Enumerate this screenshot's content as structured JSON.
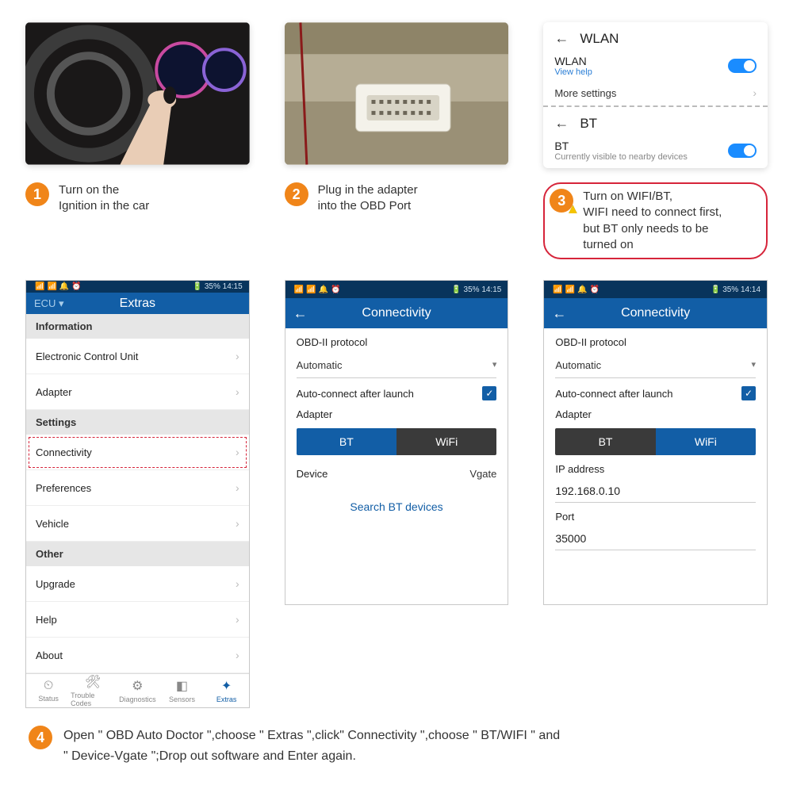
{
  "step1": {
    "num": "1",
    "text": "Turn on the\nIgnition in the car"
  },
  "step2": {
    "num": "2",
    "text": "Plug in the adapter\ninto the OBD Port"
  },
  "step3": {
    "num": "3",
    "text": "Turn on WIFI/BT,\nWIFI need to connect first,\nbut BT only needs to be\nturned on"
  },
  "step4": {
    "num": "4",
    "text": "Open \" OBD Auto Doctor \",choose \" Extras \",click\" Connectivity \",choose \" BT/WIFI \" and\n\" Device-Vgate \";Drop out software and Enter again."
  },
  "settings": {
    "wlan": {
      "title": "WLAN",
      "label": "WLAN",
      "help": "View help",
      "more": "More settings"
    },
    "bt": {
      "title": "BT",
      "label": "BT",
      "sub": "Currently visible to nearby devices"
    }
  },
  "extras": {
    "statusTime": "14:15",
    "statusBatt": "35%",
    "ecu": "ECU  ▾",
    "title": "Extras",
    "sec_info": "Information",
    "i_ecu": "Electronic Control Unit",
    "i_adapter": "Adapter",
    "sec_settings": "Settings",
    "i_conn": "Connectivity",
    "i_pref": "Preferences",
    "i_vehicle": "Vehicle",
    "sec_other": "Other",
    "i_upgrade": "Upgrade",
    "i_help": "Help",
    "i_about": "About",
    "nav": {
      "status": "Status",
      "codes": "Trouble Codes",
      "diag": "Diagnostics",
      "sensors": "Sensors",
      "extras": "Extras"
    }
  },
  "conn_bt": {
    "statusTime": "14:15",
    "statusBatt": "35%",
    "title": "Connectivity",
    "proto_lbl": "OBD-II protocol",
    "proto_val": "Automatic",
    "auto_lbl": "Auto-connect after launch",
    "adapter_lbl": "Adapter",
    "seg_bt": "BT",
    "seg_wifi": "WiFi",
    "device_lbl": "Device",
    "device_val": "Vgate",
    "search": "Search  BT  devices"
  },
  "conn_wifi": {
    "statusTime": "14:14",
    "statusBatt": "35%",
    "title": "Connectivity",
    "proto_lbl": "OBD-II protocol",
    "proto_val": "Automatic",
    "auto_lbl": "Auto-connect after launch",
    "adapter_lbl": "Adapter",
    "seg_bt": "BT",
    "seg_wifi": "WiFi",
    "ip_lbl": "IP address",
    "ip_val": "192.168.0.10",
    "port_lbl": "Port",
    "port_val": "35000"
  }
}
